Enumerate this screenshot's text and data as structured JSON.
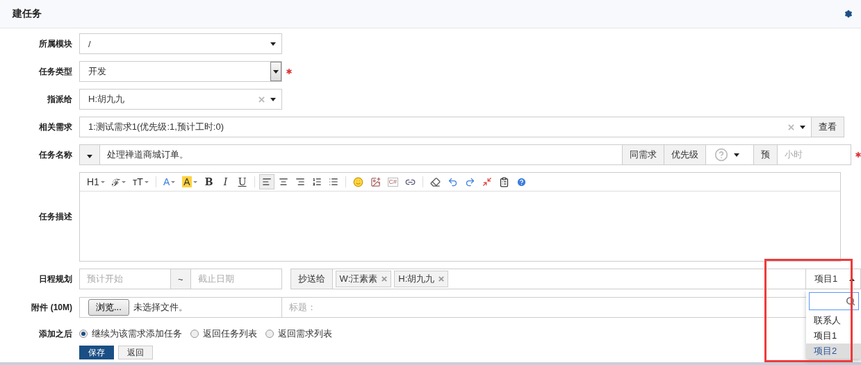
{
  "header": {
    "title": "建任务"
  },
  "module": {
    "label": "所属模块",
    "value": "/"
  },
  "type": {
    "label": "任务类型",
    "value": "开发",
    "required": true
  },
  "assignee": {
    "label": "指派给",
    "value": "H:胡九九"
  },
  "story": {
    "label": "相关需求",
    "value": "1:测试需求1(优先级:1,预计工时:0)",
    "button": "查看"
  },
  "name": {
    "label": "任务名称",
    "value": "处理禅道商城订单。",
    "same_button": "同需求",
    "priority_label": "优先级",
    "estimate_label": "预",
    "estimate_placeholder": "小时",
    "required": true
  },
  "description": {
    "label": "任务描述",
    "text_tools": [
      {
        "label": "H1"
      },
      {
        "label": "ℱ"
      },
      {
        "label": "тT"
      }
    ],
    "color_tools": [
      {
        "label": "A",
        "kind": "font"
      },
      {
        "label": "A",
        "kind": "highlight"
      }
    ],
    "format_tools": [
      {
        "label": "B"
      },
      {
        "label": "I"
      },
      {
        "label": "U"
      }
    ],
    "align_tools": [
      {
        "selected": true
      },
      {
        "selected": false
      },
      {
        "selected": false
      }
    ],
    "code_label": "C#"
  },
  "schedule": {
    "label": "日程规划",
    "start_placeholder": "预计开始",
    "separator": "~",
    "end_placeholder": "截止日期"
  },
  "mailto": {
    "label": "抄送给",
    "tags": [
      "W:汪素素",
      "H:胡九九"
    ],
    "contact_select": {
      "value": "项目1",
      "expanded": true,
      "options": [
        {
          "label": "联系人",
          "highlighted": false
        },
        {
          "label": "项目1",
          "highlighted": false
        },
        {
          "label": "项目2",
          "highlighted": true
        }
      ]
    }
  },
  "attachment": {
    "label": "附件 (10M)",
    "browse": "浏览...",
    "status": "未选择文件。",
    "title_placeholder": "标题："
  },
  "after": {
    "label": "添加之后",
    "options": [
      {
        "label": "继续为该需求添加任务",
        "selected": true
      },
      {
        "label": "返回任务列表",
        "selected": false
      },
      {
        "label": "返回需求列表",
        "selected": false
      }
    ]
  },
  "actions": {
    "save": "保存",
    "back": "返回"
  }
}
